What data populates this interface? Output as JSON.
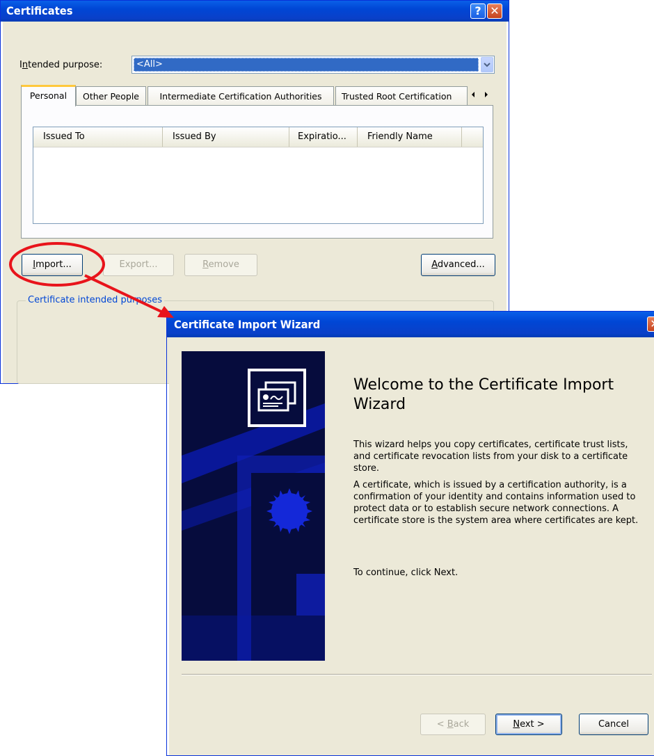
{
  "certificates_dialog": {
    "title": "Certificates",
    "intended_purpose_label_pre": "I",
    "intended_purpose_label_accel": "n",
    "intended_purpose_label_post": "tended purpose:",
    "intended_purpose_value": "<All>",
    "tabs": [
      {
        "label": "Personal"
      },
      {
        "label": "Other People"
      },
      {
        "label": "Intermediate Certification Authorities"
      },
      {
        "label": "Trusted Root Certification"
      }
    ],
    "columns": [
      "Issued To",
      "Issued By",
      "Expiratio...",
      "Friendly Name"
    ],
    "buttons": {
      "import_accel": "I",
      "import_rest": "mport...",
      "export": "Export...",
      "remove_accel": "R",
      "remove_rest": "emove",
      "advanced_accel": "A",
      "advanced_rest": "dvanced..."
    },
    "group_label": "Certificate intended purposes"
  },
  "wizard_dialog": {
    "title": "Certificate Import Wizard",
    "heading": "Welcome to the Certificate Import Wizard",
    "paragraph1": "This wizard helps you copy certificates, certificate trust lists, and certificate revocation lists from your disk to a certificate store.",
    "paragraph2": "A certificate, which is issued by a certification authority, is a confirmation of your identity and contains information used to protect data or to establish secure network connections. A certificate store is the system area where certificates are kept.",
    "paragraph3": "To continue, click Next.",
    "buttons": {
      "back_pre": "< ",
      "back_accel": "B",
      "back_rest": "ack",
      "next_accel": "N",
      "next_rest": "ext >",
      "cancel": "Cancel"
    }
  },
  "colors": {
    "title_blue": "#0046d5",
    "dialog_face": "#ece9d8",
    "selection_blue": "#316ac5",
    "annotation_red": "#e8141b",
    "wizard_graphic_navy": "#060c3d"
  },
  "icons": [
    "help-icon",
    "close-icon",
    "dropdown-arrow-icon",
    "tab-scroll-left-icon",
    "tab-scroll-right-icon",
    "certificate-icon",
    "seal-icon"
  ]
}
